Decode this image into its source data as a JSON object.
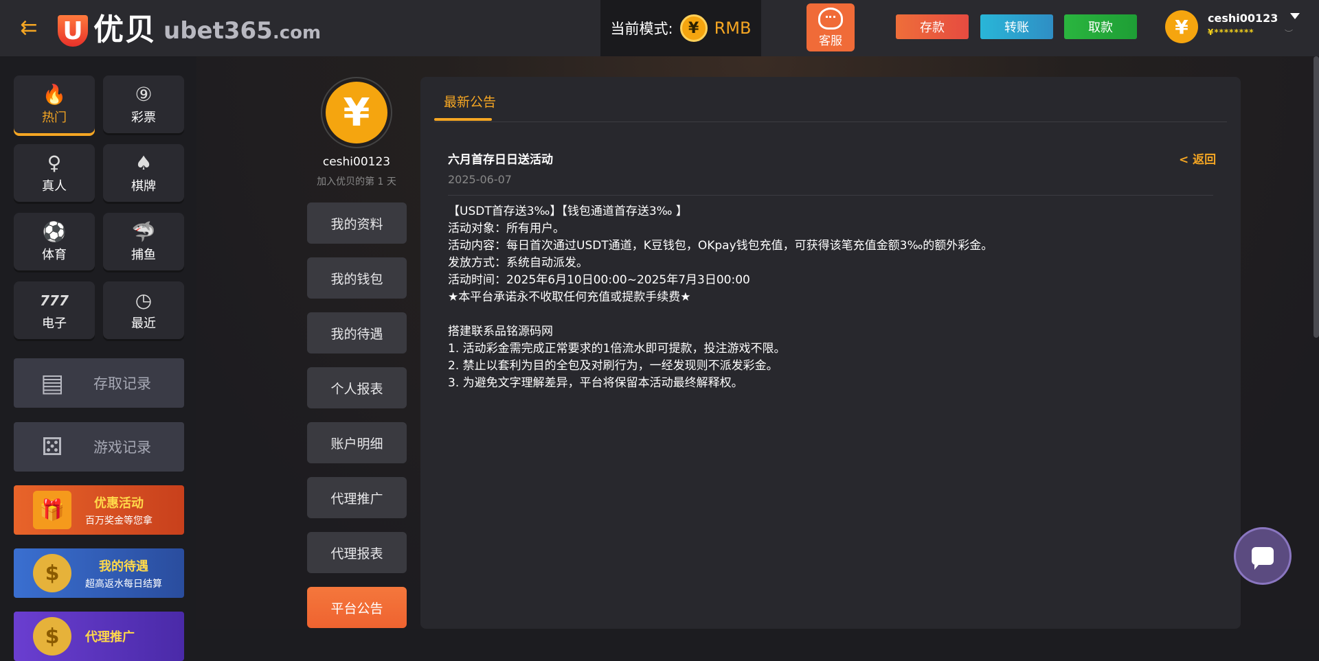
{
  "header": {
    "logo_letter": "U",
    "logo_cn": "优贝",
    "logo_domain": "ubet365",
    "logo_tld": ".com",
    "mode_label": "当前模式:",
    "mode_currency_symbol": "¥",
    "mode_currency": "RMB",
    "customer_service": "客服",
    "deposit": "存款",
    "transfer": "转账",
    "withdraw": "取款",
    "username": "ceshi00123",
    "balance_masked": "¥********",
    "avatar_symbol": "¥"
  },
  "sidebar": {
    "tiles": [
      {
        "label": "热门",
        "icon": "fire-icon",
        "glyph": "🔥"
      },
      {
        "label": "彩票",
        "icon": "lottery-ball-icon",
        "glyph": "⑨"
      },
      {
        "label": "真人",
        "icon": "live-dealer-icon",
        "glyph": "♀"
      },
      {
        "label": "棋牌",
        "icon": "playing-cards-icon",
        "glyph": "♠"
      },
      {
        "label": "体育",
        "icon": "soccer-ball-icon",
        "glyph": "⚽"
      },
      {
        "label": "捕鱼",
        "icon": "fish-icon",
        "glyph": "🦈"
      },
      {
        "label": "电子",
        "icon": "slot-777-icon",
        "glyph": "777"
      },
      {
        "label": "最近",
        "icon": "clock-icon",
        "glyph": "◷"
      }
    ],
    "records": [
      {
        "label": "存取记录",
        "icon": "coins-record-icon",
        "glyph": "▤"
      },
      {
        "label": "游戏记录",
        "icon": "dice-record-icon",
        "glyph": "⚄"
      }
    ],
    "promos": [
      {
        "title": "优惠活动",
        "subtitle": "百万奖金等您拿",
        "icon": "gift-icon",
        "glyph": "🎁",
        "bg": "#dd5a28"
      },
      {
        "title": "我的待遇",
        "subtitle": "超高返水每日结算",
        "icon": "dollar-coin-icon",
        "glyph": "$",
        "bg": "#2f5bb0"
      },
      {
        "title": "代理推广",
        "subtitle": "",
        "icon": "agent-coin-icon",
        "glyph": "$",
        "bg": "#5a35b8"
      }
    ]
  },
  "profile": {
    "avatar_symbol": "¥",
    "name": "ceshi00123",
    "join_text": "加入优贝的第 1 天"
  },
  "menu": [
    {
      "label": "我的资料"
    },
    {
      "label": "我的钱包"
    },
    {
      "label": "我的待遇"
    },
    {
      "label": "个人报表"
    },
    {
      "label": "账户明细"
    },
    {
      "label": "代理推广"
    },
    {
      "label": "代理报表"
    },
    {
      "label": "平台公告"
    }
  ],
  "panel": {
    "tab": "最新公告",
    "back": "返回",
    "back_chevron": "<",
    "title": "六月首存日日送活动",
    "date": "2025-06-07",
    "body": [
      "【USDT首存送3‰】【钱包通道首存送3‰ 】",
      "活动对象：所有用户。",
      "活动内容：每日首次通过USDT通道，K豆钱包，OKpay钱包充值，可获得该笔充值金额3‰的额外彩金。",
      "发放方式：系统自动派发。",
      "活动时间：2025年6月10日00:00~2025年7月3日00:00",
      "★本平台承诺永不收取任何充值或提款手续费★",
      "",
      "搭建联系品铭源码网",
      "1. 活动彩金需完成正常要求的1倍流水即可提款，投注游戏不限。",
      "2. 禁止以套利为目的全包及对刷行为，一经发现则不派发彩金。",
      "3. 为避免文字理解差异，平台将保留本活动最终解释权。"
    ]
  },
  "colors": {
    "accent": "#f5a623",
    "header_bg": "#2a2a2f",
    "panel_bg": "#28282d",
    "active_nav": "#ef6330"
  }
}
